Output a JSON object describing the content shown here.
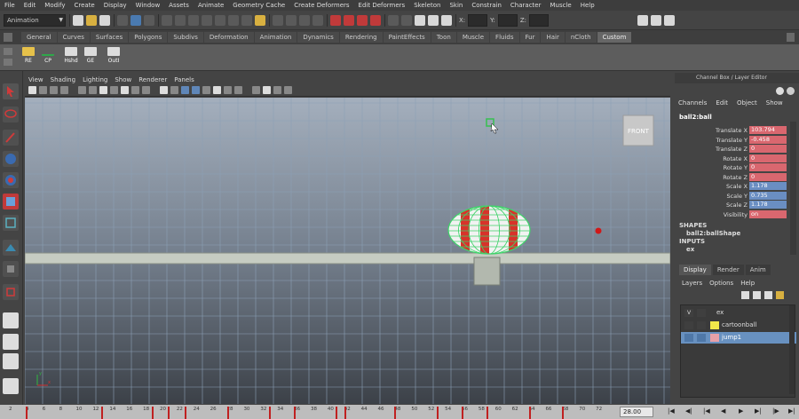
{
  "menubar": [
    "File",
    "Edit",
    "Modify",
    "Create",
    "Display",
    "Window",
    "Assets",
    "Animate",
    "Geometry Cache",
    "Create Deformers",
    "Edit Deformers",
    "Skeleton",
    "Skin",
    "Constrain",
    "Character",
    "Muscle",
    "Help"
  ],
  "status": {
    "mode": "Animation",
    "coord_labels": [
      "X:",
      "Y:",
      "Z:"
    ]
  },
  "shelf_tabs": [
    "General",
    "Curves",
    "Surfaces",
    "Polygons",
    "Subdivs",
    "Deformation",
    "Animation",
    "Dynamics",
    "Rendering",
    "PaintEffects",
    "Toon",
    "Muscle",
    "Fluids",
    "Fur",
    "Hair",
    "nCloth",
    "Custom"
  ],
  "shelf_active": "Custom",
  "shelf_items": [
    "RE",
    "CP",
    "Hshd",
    "GE",
    "OutI"
  ],
  "panel_menu": [
    "View",
    "Shading",
    "Lighting",
    "Show",
    "Renderer",
    "Panels"
  ],
  "viewport": {
    "view_cube_label": "FRONT"
  },
  "channel_box": {
    "title": "Channel Box / Layer Editor",
    "menu": [
      "Channels",
      "Edit",
      "Object",
      "Show"
    ],
    "object": "ball2:ball",
    "attributes": [
      {
        "label": "Translate X",
        "value": "103.794",
        "color": "red"
      },
      {
        "label": "Translate Y",
        "value": "-0.458",
        "color": "red"
      },
      {
        "label": "Translate Z",
        "value": "0",
        "color": "red"
      },
      {
        "label": "Rotate X",
        "value": "0",
        "color": "red"
      },
      {
        "label": "Rotate Y",
        "value": "0",
        "color": "red"
      },
      {
        "label": "Rotate Z",
        "value": "0",
        "color": "red"
      },
      {
        "label": "Scale X",
        "value": "1.178",
        "color": "blue"
      },
      {
        "label": "Scale Y",
        "value": "0.735",
        "color": "blue"
      },
      {
        "label": "Scale Z",
        "value": "1.178",
        "color": "blue"
      },
      {
        "label": "Visibility",
        "value": "on",
        "color": "red"
      }
    ],
    "shapes_header": "SHAPES",
    "shape_name": "ball2:ballShape",
    "inputs_header": "INPUTS",
    "inputs_item": "ex"
  },
  "layer_editor": {
    "tabs": [
      "Display",
      "Render",
      "Anim"
    ],
    "active_tab": "Display",
    "menu": [
      "Layers",
      "Options",
      "Help"
    ],
    "rows": [
      {
        "vis": "V",
        "name": "ex",
        "color": "",
        "selected": false
      },
      {
        "vis": "",
        "name": "cartoonball",
        "color": "#f2e84a",
        "selected": false
      },
      {
        "vis": "",
        "name": "jump1",
        "color": "#e8a0a8",
        "selected": true
      }
    ]
  },
  "timeline": {
    "ticks": [
      "2",
      "4",
      "6",
      "8",
      "10",
      "12",
      "14",
      "16",
      "18",
      "20",
      "22",
      "24",
      "26",
      "28",
      "30",
      "32",
      "34",
      "36",
      "38",
      "40",
      "42",
      "44",
      "46",
      "48",
      "50",
      "52",
      "54",
      "56",
      "58",
      "60",
      "62",
      "64",
      "66",
      "68",
      "70",
      "72"
    ],
    "current_frame": "28.00",
    "keys": [
      4,
      13,
      19,
      21,
      23,
      28,
      33,
      36,
      41,
      42,
      48,
      53,
      56,
      59,
      64,
      68
    ]
  },
  "colors": {
    "key": "#c02020",
    "ball_red": "#d8322a",
    "ball_white": "#f2f2f2",
    "wire": "#3fd36a",
    "grid_line": "#8ca0b6"
  }
}
